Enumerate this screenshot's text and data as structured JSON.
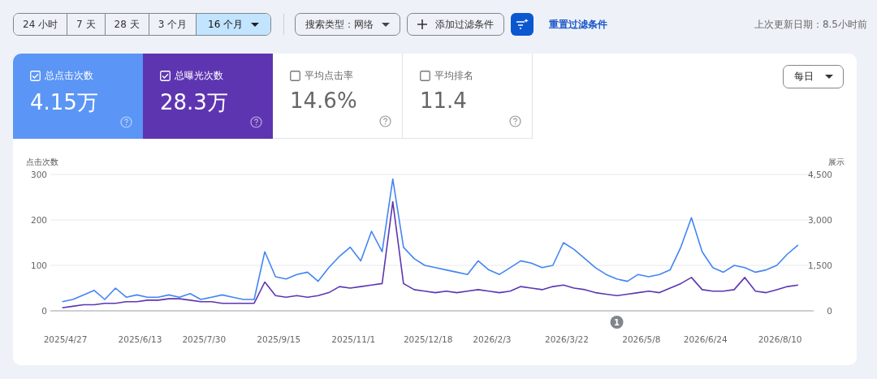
{
  "toolbar": {
    "date_ranges": [
      {
        "label": "24 小时",
        "selected": false
      },
      {
        "label": "7 天",
        "selected": false
      },
      {
        "label": "28 天",
        "selected": false
      },
      {
        "label": "3 个月",
        "selected": false
      },
      {
        "label": "16 个月",
        "selected": true
      }
    ],
    "search_type": "搜索类型：网络",
    "add_filter": "添加过滤条件",
    "reset_filters": "重置过滤条件",
    "last_updated": "上次更新日期：8.5小时前"
  },
  "metrics": [
    {
      "label": "总点击次数",
      "value": "4.15万",
      "checked": true,
      "color": "#5b95f5"
    },
    {
      "label": "总曝光次数",
      "value": "28.3万",
      "checked": true,
      "color": "#5e35b1"
    },
    {
      "label": "平均点击率",
      "value": "14.6%",
      "checked": false
    },
    {
      "label": "平均排名",
      "value": "11.4",
      "checked": false
    }
  ],
  "granularity": "每日",
  "chart_data": {
    "type": "line",
    "ylabel": "点击次数",
    "y2label": "展示",
    "ylim": [
      0,
      300
    ],
    "y2lim": [
      0,
      4500
    ],
    "yticks": [
      0,
      100,
      200,
      300
    ],
    "y2ticks": [
      {
        "value": 0,
        "label": "0"
      },
      {
        "value": 1500,
        "label": "1,500"
      },
      {
        "value": 3000,
        "label": "3,000"
      },
      {
        "value": 4500,
        "label": "4,500"
      }
    ],
    "categories": [
      "2025/4/27",
      null,
      null,
      null,
      null,
      null,
      null,
      "2025/6/13",
      null,
      null,
      null,
      null,
      null,
      "2025/7/30",
      null,
      null,
      null,
      null,
      null,
      null,
      "2025/9/15",
      null,
      null,
      null,
      null,
      null,
      null,
      "2025/11/1",
      null,
      null,
      null,
      null,
      null,
      null,
      "2025/12/18",
      null,
      null,
      null,
      null,
      null,
      "2026/2/3",
      null,
      null,
      null,
      null,
      null,
      null,
      "2026/3/22",
      null,
      null,
      null,
      null,
      null,
      null,
      "2026/5/8",
      null,
      null,
      null,
      null,
      null,
      "2026/6/24",
      null,
      null,
      null,
      null,
      null,
      null,
      "2026/8/10",
      null,
      null
    ],
    "series": [
      {
        "color": "#4285f4",
        "values": [
          20,
          25,
          35,
          45,
          25,
          50,
          30,
          35,
          30,
          30,
          35,
          30,
          38,
          25,
          30,
          35,
          30,
          25,
          25,
          130,
          75,
          70,
          80,
          85,
          65,
          95,
          120,
          140,
          110,
          175,
          130,
          290,
          140,
          115,
          100,
          95,
          90,
          85,
          80,
          110,
          90,
          80,
          95,
          110,
          105,
          95,
          100,
          150,
          135,
          115,
          95,
          80,
          70,
          65,
          80,
          75,
          80,
          90,
          140,
          205,
          130,
          95,
          85,
          100,
          95,
          85,
          90,
          100,
          125,
          145
        ]
      },
      {
        "color": "#5e35b1",
        "axis": "y2",
        "values": [
          100,
          150,
          200,
          200,
          250,
          250,
          300,
          300,
          350,
          350,
          400,
          400,
          350,
          300,
          300,
          250,
          250,
          250,
          250,
          950,
          500,
          450,
          500,
          450,
          500,
          600,
          800,
          750,
          800,
          850,
          900,
          3600,
          900,
          700,
          650,
          600,
          650,
          600,
          650,
          700,
          650,
          600,
          650,
          800,
          750,
          700,
          800,
          850,
          750,
          700,
          600,
          550,
          500,
          550,
          600,
          650,
          600,
          750,
          900,
          1100,
          700,
          650,
          650,
          700,
          1100,
          650,
          600,
          700,
          800,
          850
        ]
      }
    ],
    "annotations": [
      "1"
    ]
  }
}
